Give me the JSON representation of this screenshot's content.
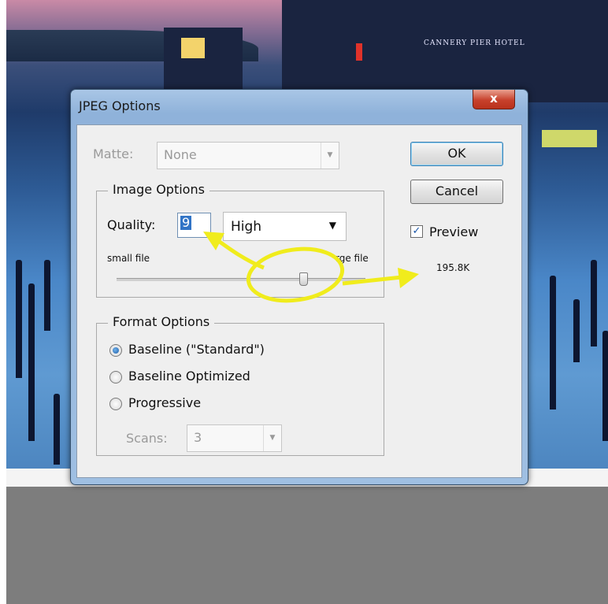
{
  "dialog": {
    "title": "JPEG Options",
    "close_label": "x"
  },
  "matte": {
    "label": "Matte:",
    "value": "None"
  },
  "image_options": {
    "title": "Image Options",
    "quality_label": "Quality:",
    "quality_value": "9",
    "quality_preset": "High",
    "small_label": "small file",
    "large_label": "rge file",
    "slider_level": 0.75
  },
  "buttons": {
    "ok": "OK",
    "cancel": "Cancel"
  },
  "preview": {
    "label": "Preview",
    "checked": true,
    "size": "195.8K"
  },
  "format_options": {
    "title": "Format Options",
    "options": [
      {
        "label": "Baseline (\"Standard\")",
        "selected": true
      },
      {
        "label": "Baseline Optimized",
        "selected": false
      },
      {
        "label": "Progressive",
        "selected": false
      }
    ],
    "scans_label": "Scans:",
    "scans_value": "3"
  },
  "icons": {
    "checkmark": "check-icon",
    "dropdown": "chevron-down-icon",
    "close": "close-icon"
  },
  "colors": {
    "annotation": "#f0ec1c",
    "selection": "#3174c6"
  }
}
